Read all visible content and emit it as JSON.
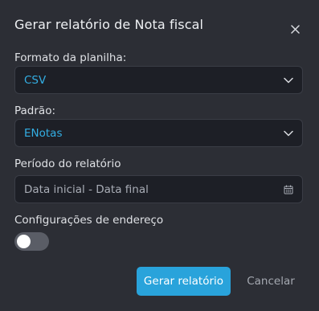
{
  "dialog": {
    "title": "Gerar relatório de Nota fiscal",
    "close_icon": "close-icon"
  },
  "fields": {
    "format": {
      "label": "Formato da planilha:",
      "value": "CSV",
      "icon": "chevron-down-icon"
    },
    "standard": {
      "label": "Padrão:",
      "value": "ENotas",
      "icon": "chevron-down-icon"
    },
    "period": {
      "label": "Período do relatório",
      "placeholder": "Data inicial - Data final",
      "icon": "calendar-icon"
    },
    "address": {
      "label": "Configurações de endereço",
      "enabled": false
    }
  },
  "actions": {
    "generate_label": "Gerar relatório",
    "cancel_label": "Cancelar"
  },
  "colors": {
    "background": "#2c2e35",
    "field_bg": "#1d1f26",
    "accent": "#29a3db",
    "value_text": "#33aee3"
  }
}
